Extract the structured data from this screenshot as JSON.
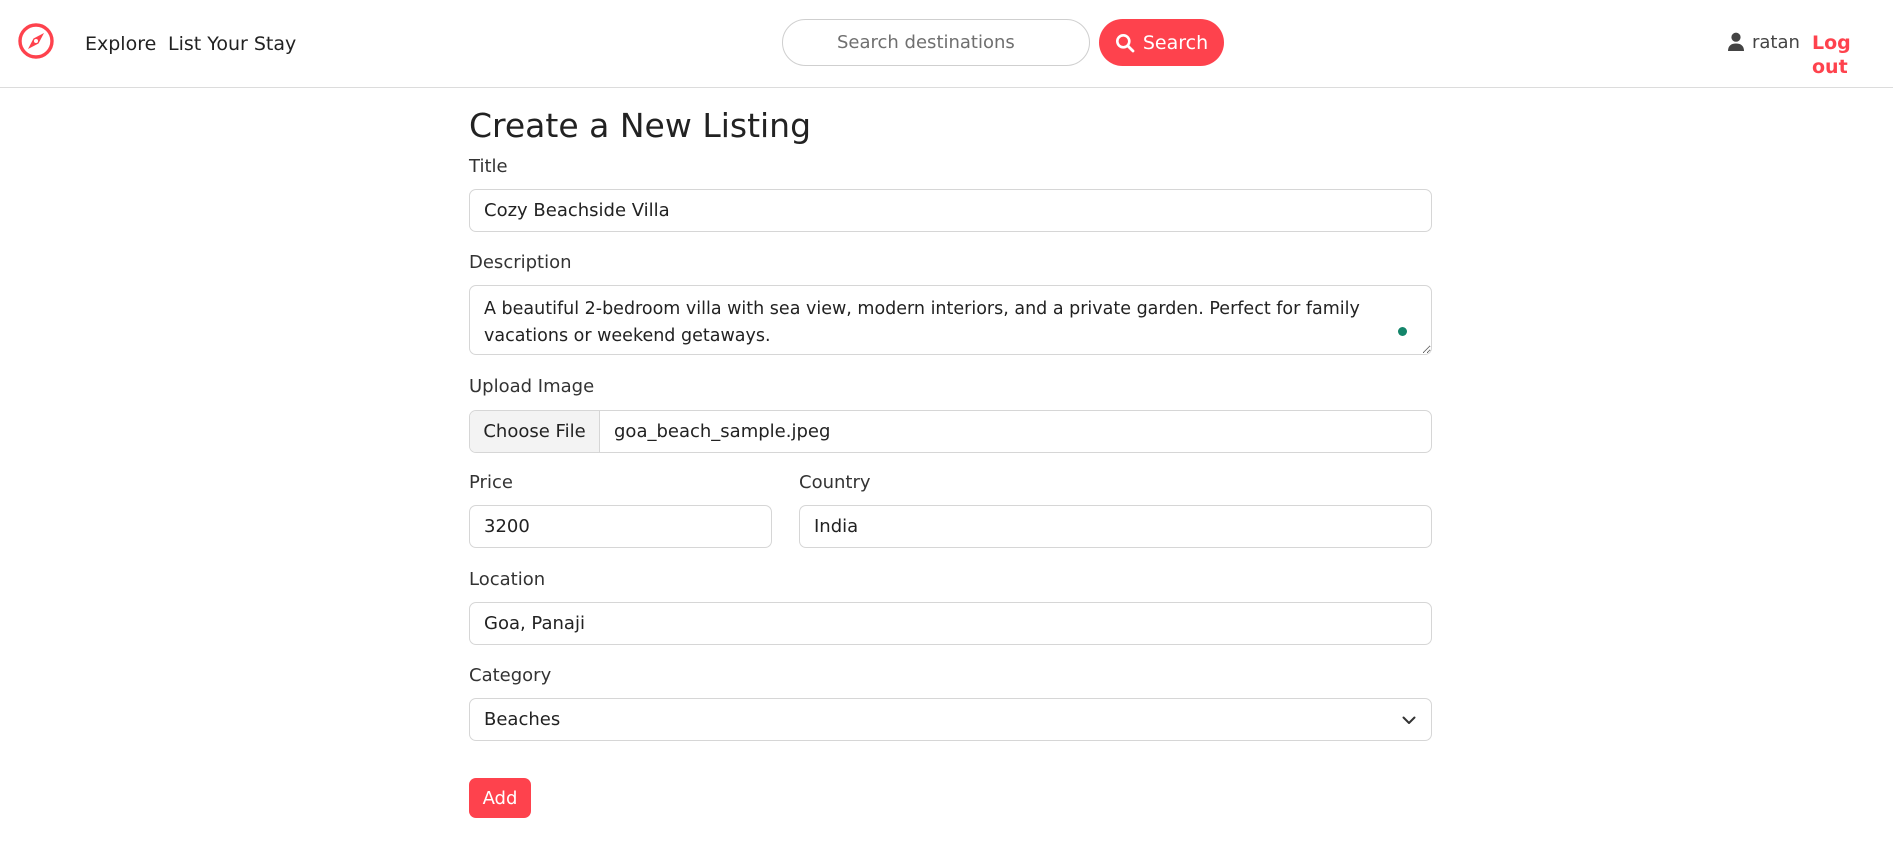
{
  "nav": {
    "explore_label": "Explore",
    "list_label": "List Your Stay",
    "search_placeholder": "Search destinations",
    "search_button_label": "Search",
    "username": "ratan",
    "logout_label": "Log out"
  },
  "form": {
    "title_heading": "Create a New Listing",
    "title_label": "Title",
    "title_value": "Cozy Beachside Villa",
    "description_label": "Description",
    "description_value": "A beautiful 2-bedroom villa with sea view, modern interiors, and a private garden. Perfect for family vacations or weekend getaways.",
    "image_label": "Upload Image",
    "choose_file_label": "Choose File",
    "file_name": "goa_beach_sample.jpeg",
    "price_label": "Price",
    "price_value": "3200",
    "country_label": "Country",
    "country_value": "India",
    "location_label": "Location",
    "location_value": "Goa, Panaji",
    "category_label": "Category",
    "category_value": "Beaches",
    "add_button_label": "Add"
  },
  "colors": {
    "brand": "#fe424d",
    "grammar_dot": "#14856a"
  },
  "icons": [
    "compass-logo-icon",
    "search-icon",
    "user-icon",
    "chevron-down-icon"
  ]
}
